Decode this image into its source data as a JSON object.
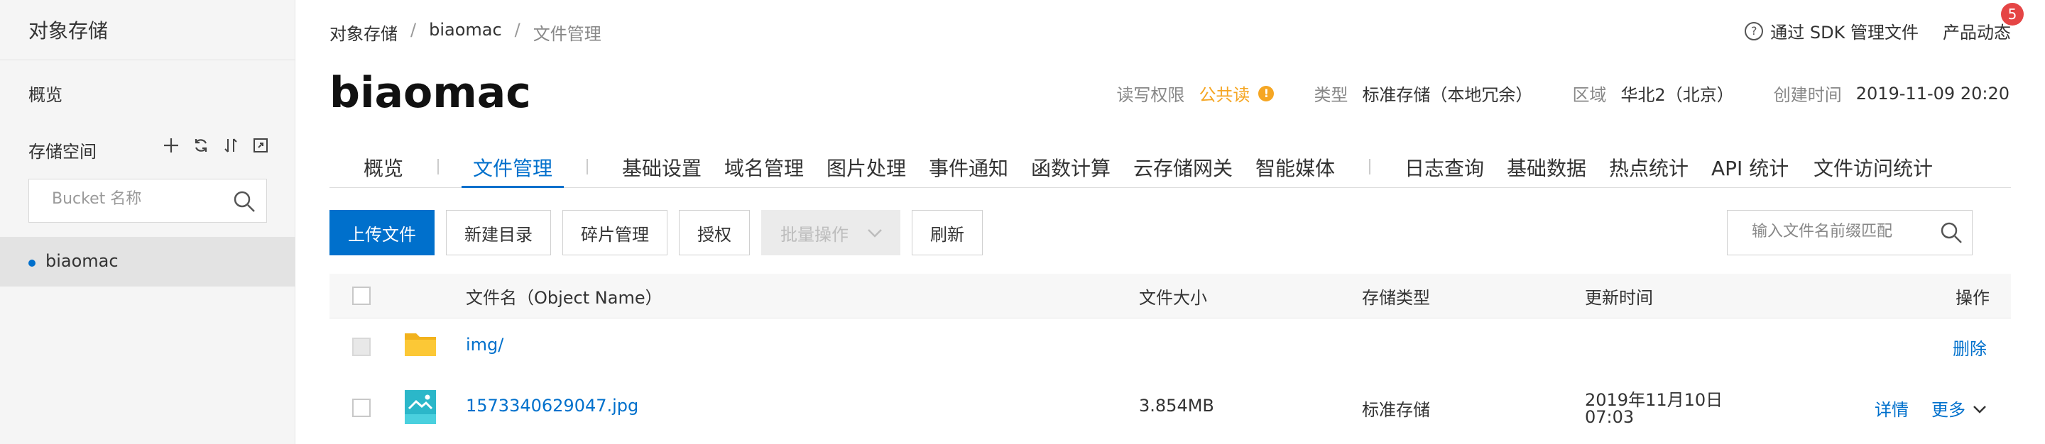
{
  "sidebar": {
    "title": "对象存储",
    "overview": "概览",
    "buckets_label": "存储空间",
    "search_placeholder": "Bucket 名称",
    "items": [
      {
        "label": "biaomac"
      }
    ]
  },
  "breadcrumb": [
    "对象存储",
    "biaomac",
    "文件管理"
  ],
  "header": {
    "sdk_link": "通过 SDK 管理文件",
    "news": "产品动态",
    "news_badge": "5",
    "bucket_name": "biaomac"
  },
  "meta": {
    "acl_label": "读写权限",
    "acl_value": "公共读",
    "type_label": "类型",
    "type_value": "标准存储（本地冗余）",
    "region_label": "区域",
    "region_value": "华北2（北京）",
    "created_label": "创建时间",
    "created_value": "2019-11-09 20:20"
  },
  "tabs": [
    "概览",
    "文件管理",
    "基础设置",
    "域名管理",
    "图片处理",
    "事件通知",
    "函数计算",
    "云存储网关",
    "智能媒体",
    "日志查询",
    "基础数据",
    "热点统计",
    "API 统计",
    "文件访问统计"
  ],
  "toolbar": {
    "upload": "上传文件",
    "new_dir": "新建目录",
    "fragments": "碎片管理",
    "authorize": "授权",
    "batch": "批量操作",
    "refresh": "刷新",
    "search_placeholder": "输入文件名前缀匹配"
  },
  "table": {
    "headers": {
      "name": "文件名（Object Name）",
      "size": "文件大小",
      "storage": "存储类型",
      "updated": "更新时间",
      "actions": "操作"
    },
    "rows": [
      {
        "name": "img/",
        "size": "",
        "storage": "",
        "updated": "",
        "action1": "删除",
        "icon": "folder-icon"
      },
      {
        "name": "1573340629047.jpg",
        "size": "3.854MB",
        "storage": "标准存储",
        "updated_line1": "2019年11月10日",
        "updated_line2": "07:03",
        "action1": "详情",
        "action2": "更多",
        "icon": "image-file-icon"
      }
    ]
  },
  "colors": {
    "accent": "#0070cc",
    "warning": "#f5a623",
    "badge": "#e54545"
  }
}
